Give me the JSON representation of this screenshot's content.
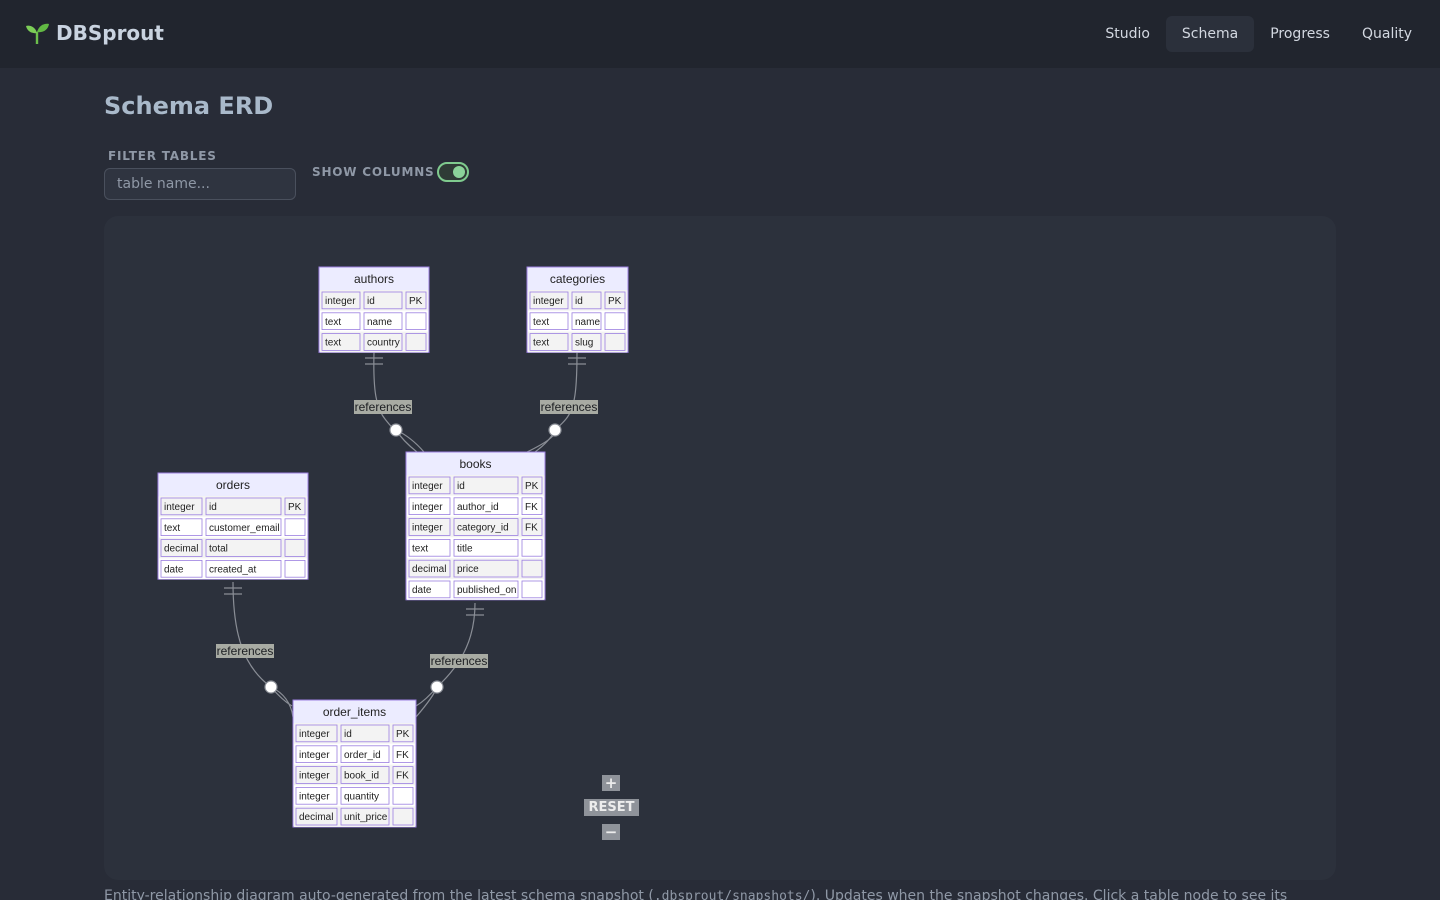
{
  "app": {
    "brand": "DBSprout",
    "brand_icon": "sprout-icon"
  },
  "nav": {
    "items": [
      {
        "label": "Studio",
        "active": false
      },
      {
        "label": "Schema",
        "active": true
      },
      {
        "label": "Progress",
        "active": false
      },
      {
        "label": "Quality",
        "active": false
      }
    ]
  },
  "page": {
    "title": "Schema ERD"
  },
  "controls": {
    "filter_label": "FILTER TABLES",
    "filter_placeholder": "table name...",
    "filter_value": "",
    "show_columns_label": "SHOW COLUMNS",
    "show_columns_on": true
  },
  "erd": {
    "tables": [
      {
        "id": "authors",
        "name": "authors",
        "columns": [
          {
            "type": "integer",
            "name": "id",
            "key": "PK"
          },
          {
            "type": "text",
            "name": "name",
            "key": ""
          },
          {
            "type": "text",
            "name": "country",
            "key": ""
          }
        ]
      },
      {
        "id": "categories",
        "name": "categories",
        "columns": [
          {
            "type": "integer",
            "name": "id",
            "key": "PK"
          },
          {
            "type": "text",
            "name": "name",
            "key": ""
          },
          {
            "type": "text",
            "name": "slug",
            "key": ""
          }
        ]
      },
      {
        "id": "books",
        "name": "books",
        "columns": [
          {
            "type": "integer",
            "name": "id",
            "key": "PK"
          },
          {
            "type": "integer",
            "name": "author_id",
            "key": "FK"
          },
          {
            "type": "integer",
            "name": "category_id",
            "key": "FK"
          },
          {
            "type": "text",
            "name": "title",
            "key": ""
          },
          {
            "type": "decimal",
            "name": "price",
            "key": ""
          },
          {
            "type": "date",
            "name": "published_on",
            "key": ""
          }
        ]
      },
      {
        "id": "orders",
        "name": "orders",
        "columns": [
          {
            "type": "integer",
            "name": "id",
            "key": "PK"
          },
          {
            "type": "text",
            "name": "customer_email",
            "key": ""
          },
          {
            "type": "decimal",
            "name": "total",
            "key": ""
          },
          {
            "type": "date",
            "name": "created_at",
            "key": ""
          }
        ]
      },
      {
        "id": "order_items",
        "name": "order_items",
        "columns": [
          {
            "type": "integer",
            "name": "id",
            "key": "PK"
          },
          {
            "type": "integer",
            "name": "order_id",
            "key": "FK"
          },
          {
            "type": "integer",
            "name": "book_id",
            "key": "FK"
          },
          {
            "type": "integer",
            "name": "quantity",
            "key": ""
          },
          {
            "type": "decimal",
            "name": "unit_price",
            "key": ""
          }
        ]
      }
    ],
    "relationships": [
      {
        "from": "authors",
        "to": "books",
        "label": "references"
      },
      {
        "from": "categories",
        "to": "books",
        "label": "references"
      },
      {
        "from": "orders",
        "to": "order_items",
        "label": "references"
      },
      {
        "from": "books",
        "to": "order_items",
        "label": "references"
      }
    ],
    "zoom": {
      "in_label": "+",
      "reset_label": "RESET",
      "out_label": "−"
    }
  },
  "caption": {
    "before_code": "Entity-relationship diagram auto-generated from the latest schema snapshot (",
    "code": ".dbsprout/snapshots/",
    "after_code": "). Updates when the snapshot changes. Click a table node to see its"
  }
}
